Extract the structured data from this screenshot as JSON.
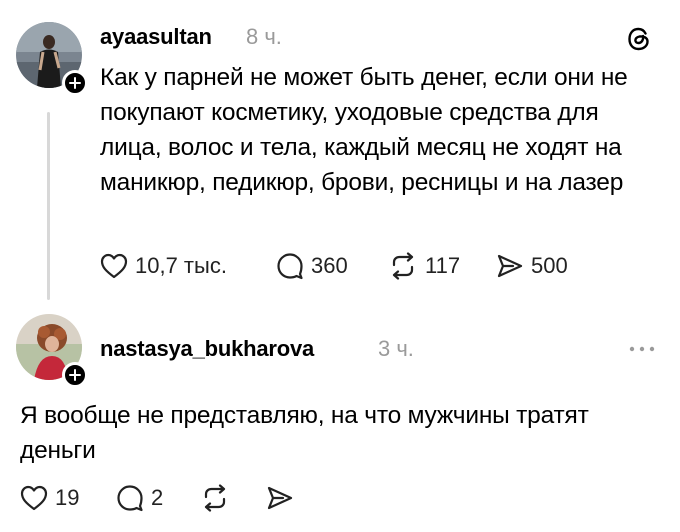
{
  "post1": {
    "username": "ayaasultan",
    "time": "8 ч.",
    "text": "Как у парней не может быть денег, если они не покупают косметику, уходовые средства для лица, волос и тела, каждый месяц не ходят на маникюр, педикюр, брови, ресницы и на лазер",
    "likes": "10,7 тыс.",
    "comments": "360",
    "reposts": "117",
    "shares": "500"
  },
  "post2": {
    "username": "nastasya_bukharova",
    "time": "3 ч.",
    "text": "Я вообще не представляю, на что мужчины тратят деньги",
    "likes": "19",
    "comments": "2"
  },
  "icons": {
    "logo": "threads-logo-icon",
    "plus": "plus-icon",
    "like": "heart-icon",
    "comment": "comment-bubble-icon",
    "repost": "repost-icon",
    "share": "share-icon",
    "more": "more-dots-icon"
  }
}
